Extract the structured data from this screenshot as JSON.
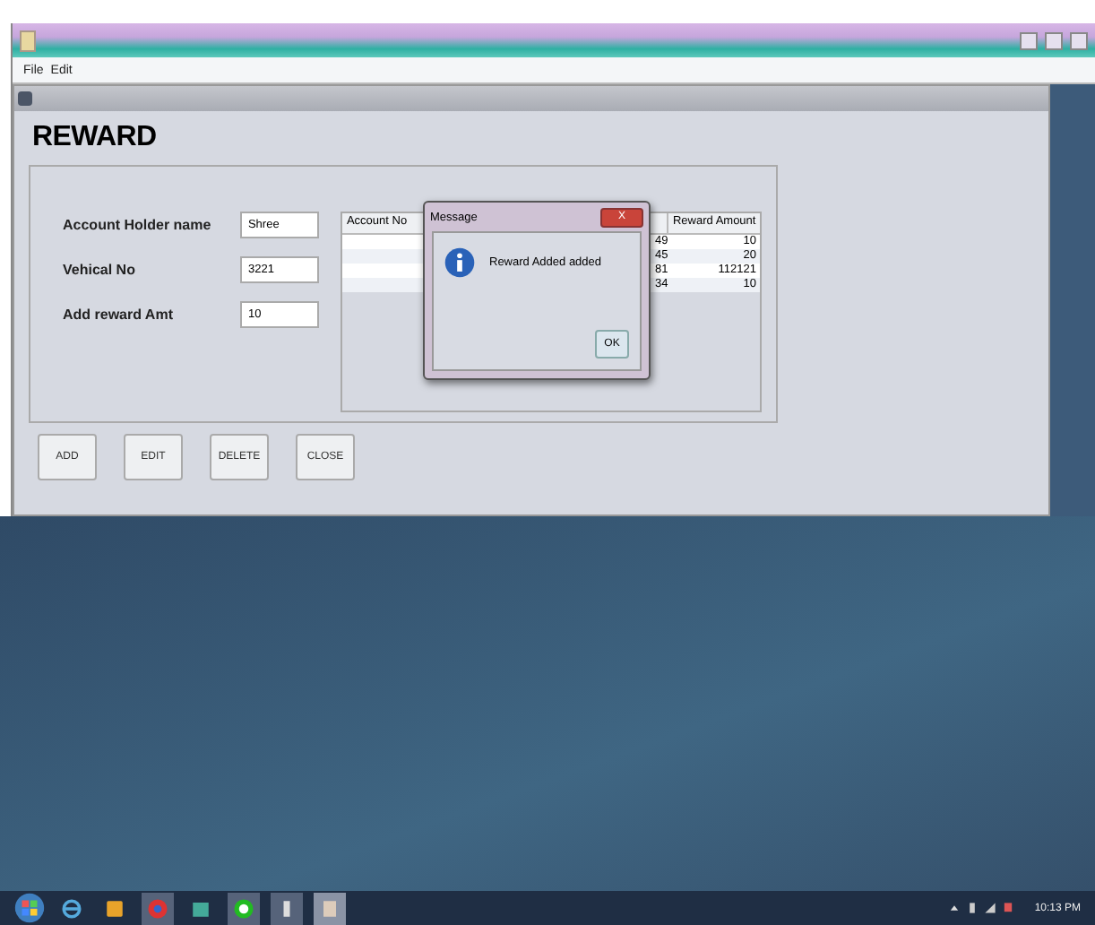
{
  "menu": [
    {
      "label": "File"
    },
    {
      "label": "Edit"
    }
  ],
  "heading": "REWARD",
  "fields": [
    {
      "label": "Account Holder name",
      "value": "Shree"
    },
    {
      "label": "Vehical No",
      "value": "3221"
    },
    {
      "label": "Add reward Amt",
      "value": "10"
    }
  ],
  "table": {
    "columns": [
      "Account No",
      "Reward Amount"
    ],
    "rows": [
      {
        "column_3": "49",
        "reward_amount": "10"
      },
      {
        "column_3": "45",
        "reward_amount": "20"
      },
      {
        "column_3": "81",
        "reward_amount": "112121"
      },
      {
        "column_3": "34",
        "reward_amount": "10"
      }
    ]
  },
  "buttons": [
    {
      "label": "ADD"
    },
    {
      "label": "EDIT"
    },
    {
      "label": "DELETE"
    },
    {
      "label": "CLOSE"
    }
  ],
  "dialog": {
    "title": "Message",
    "close": "X",
    "message": "Reward Added added",
    "ok": "OK"
  },
  "taskbar": {
    "clock": "10:13 PM"
  }
}
